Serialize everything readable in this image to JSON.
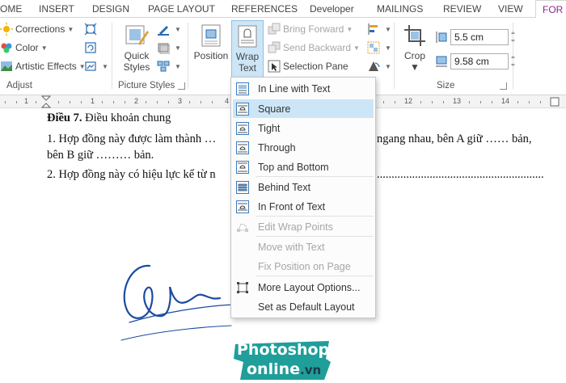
{
  "tabs": [
    {
      "label": "OME"
    },
    {
      "label": "INSERT"
    },
    {
      "label": "DESIGN"
    },
    {
      "label": "PAGE LAYOUT"
    },
    {
      "label": "REFERENCES"
    },
    {
      "label": "Developer"
    },
    {
      "label": "MAILINGS"
    },
    {
      "label": "REVIEW"
    },
    {
      "label": "VIEW"
    },
    {
      "label": "FOR"
    }
  ],
  "ribbon": {
    "adjust": {
      "corrections": "Corrections",
      "color": "Color",
      "artistic_effects": "Artistic Effects",
      "label": "Adjust"
    },
    "picture_styles": {
      "quick_styles_1": "Quick",
      "quick_styles_2": "Styles",
      "label": "Picture Styles"
    },
    "arrange": {
      "position": "Position",
      "wrap_text_1": "Wrap",
      "wrap_text_2": "Text",
      "bring_forward": "Bring Forward",
      "send_backward": "Send Backward",
      "selection_pane": "Selection Pane"
    },
    "size": {
      "crop": "Crop",
      "height_value": "5.5 cm",
      "width_value": "9.58 cm",
      "label": "Size"
    }
  },
  "document": {
    "line1_bold": "Điều 7.",
    "line1_rest": " Điều khoản chung",
    "line2_a": "1. Hợp đồng này được làm thành …",
    "line2_b": "ngang nhau, bên A giữ …… bản,",
    "line3": "bên B giữ ……… bản.",
    "line4_a": "2. Hợp đồng này có hiệu lực kể từ n",
    "line4_b": "........................................................."
  },
  "wrap_menu": {
    "items": [
      {
        "label": "In Line with Text"
      },
      {
        "label": "Square"
      },
      {
        "label": "Tight"
      },
      {
        "label": "Through"
      },
      {
        "label": "Top and Bottom"
      },
      {
        "label": "Behind Text"
      },
      {
        "label": "In Front of Text"
      },
      {
        "label": "Edit Wrap Points"
      },
      {
        "label": "Move with Text"
      },
      {
        "label": "Fix Position on Page"
      },
      {
        "label": "More Layout Options..."
      },
      {
        "label": "Set as Default Layout"
      }
    ]
  },
  "watermark": {
    "line1": "Photoshop",
    "line2": "online",
    "line2_suffix": ".vn"
  },
  "colors": {
    "accent_tab": "#8a2a8a",
    "selection": "#cde6f7",
    "icon_blue": "#2b6cb0",
    "logo_teal": "#1f9e9a"
  }
}
